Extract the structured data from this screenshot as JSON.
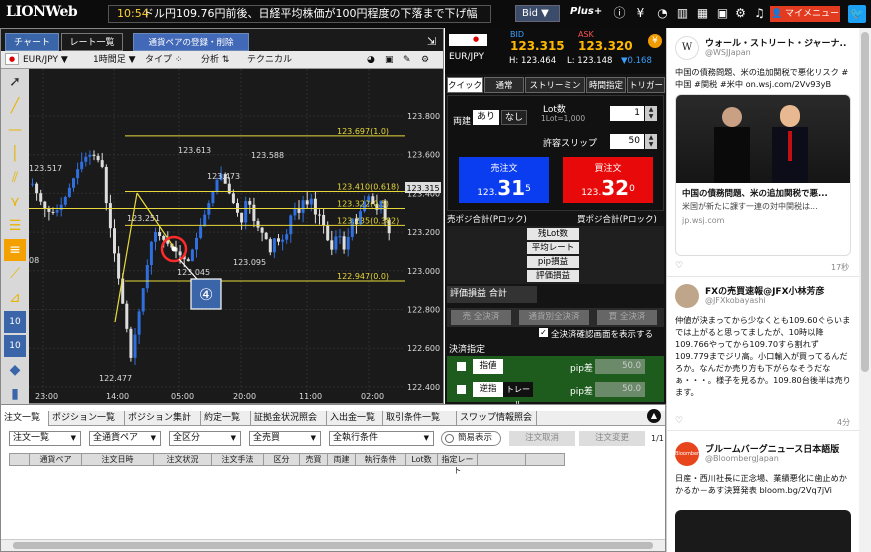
{
  "header": {
    "logo": "LIONWeb",
    "ticker_time": "10:54",
    "ticker_text": "ドル円109.76円前後、日経平均株価が100円程度の下落まで下げ幅",
    "bid_select": "Bid",
    "plus": "Plus+",
    "mymenu": "マイメニュー"
  },
  "chart": {
    "tabs": [
      "チャート",
      "レート一覧",
      "通貨ペアの登録・削除"
    ],
    "pair": "EUR/JPY",
    "interval": "1時間足",
    "type_label": "タイプ",
    "analysis_label": "分析",
    "technical_label": "テクニカル",
    "current_price": "123.315",
    "annotation": "④",
    "price_labels": [
      "123.800",
      "123.600",
      "123.400",
      "123.200",
      "123.000",
      "122.800",
      "122.600",
      "122.400"
    ],
    "time_labels": [
      "23:00",
      "14:00",
      "05:00",
      "20:00",
      "11:00",
      "02:00"
    ],
    "fib_labels": [
      "123.697(1.0)",
      "123.410(0.618)",
      "123.322(0.5)",
      "123.235(0.382)",
      "122.947(0.0)"
    ],
    "point_labels": [
      "123.613",
      "123.588",
      "123.517",
      "123.473",
      "123.251",
      "123.095",
      "123.045",
      "122.477",
      "08"
    ]
  },
  "order": {
    "pair": "EUR/JPY",
    "bid_label": "BID",
    "ask_label": "ASK",
    "bid": "123.315",
    "ask": "123.320",
    "high": "H: 123.464",
    "low": "L: 123.148",
    "change": "▼0.168",
    "tabs": [
      "クイック",
      "通常",
      "ストリーミング",
      "時間指定",
      "トリガー"
    ],
    "ryodate_label": "両建",
    "ryodate_on": "あり",
    "ryodate_off": "なし",
    "lot_label": "Lot数",
    "lot_sub": "1Lot=1,000",
    "lot_value": "1",
    "slip_label": "許容スリップ",
    "slip_value": "50",
    "sell_label": "売注文",
    "sell_price_pre": "123.",
    "sell_price_big": "31",
    "sell_price_sup": "5",
    "buy_label": "買注文",
    "buy_price_pre": "123.",
    "buy_price_big": "32",
    "buy_price_sup": "0",
    "sell_pos": "売ポジ合計(Pロック)",
    "buy_pos": "買ポジ合計(Pロック)",
    "rows": [
      "残Lot数",
      "平均レート",
      "pip損益",
      "評価損益"
    ],
    "eval_total": "評価損益 合計",
    "settle_btns": [
      "売 全決済",
      "通貨別全決済",
      "買 全決済"
    ],
    "confirm_label": "全決済確認画面を表示する",
    "settle_spec": "決済指定",
    "limit_label": "指値",
    "trail_label": "逆指",
    "trail2": "トレール",
    "pip_label": "pip差",
    "pip_value": "50.0"
  },
  "bottom": {
    "tabs": [
      "注文一覧",
      "ポジション一覧",
      "ポジション集計",
      "約定一覧",
      "証拠金状況照会",
      "入出金一覧",
      "取引条件一覧",
      "スワップ情報照会"
    ],
    "selects": [
      "注文一覧",
      "全通貨ペア",
      "全区分",
      "全売買",
      "全執行条件"
    ],
    "simple_label": "簡易表示",
    "cancel_btn": "注文取消",
    "change_btn": "注文変更",
    "page": "1/1",
    "columns": [
      "通貨ペア",
      "注文日時",
      "注文状況",
      "注文手法",
      "区分",
      "売買",
      "両建",
      "執行条件",
      "Lot数",
      "指定レート"
    ]
  },
  "twitter": [
    {
      "name": "ウォール・ストリート・ジャーナ..",
      "handle": "@WSJJapan",
      "body": "中国の債務問題、米の追加関税で悪化リスク #中国 #関税 #米中 on.wsj.com/2Vv93yB",
      "card_title": "中国の債務問題、米の追加関税で悪...",
      "card_desc": "米国が新たに課す一連の対中関税は...",
      "card_url": "jp.wsj.com",
      "time": "17秒"
    },
    {
      "name": "FXの売買速報@JFX小林芳彦",
      "handle": "@JFXkobayashi",
      "body": "仲値が決まってから少なくとも109.60ぐらいまでは上がると思ってましたが、10時以降109.766やってから109.70すら割れず109.779までジリ高。小口輸入が買ってるんだろか。なんだか売り方も下がらなそうだなぁ・・・。様子を見るか。109.80台後半は売ります。",
      "time": "4分"
    },
    {
      "name": "ブルームバーグニュース日本語版",
      "handle": "@BloombergJapan",
      "body": "日産・西川社長に正念場、業績悪化に歯止めかかるか－あす決算発表 bloom.bg/2Vq7jVi"
    }
  ]
}
